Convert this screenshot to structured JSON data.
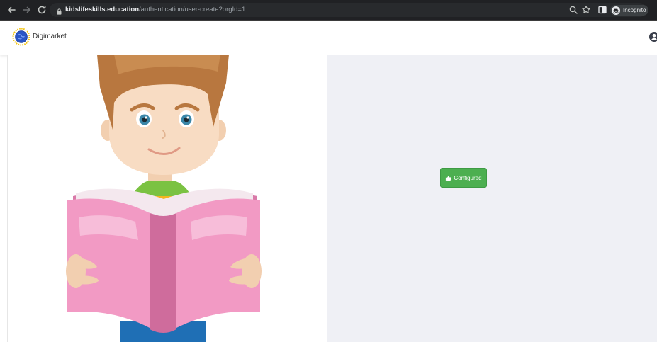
{
  "browser": {
    "url_host": "kidslifeskills.education",
    "url_path": "/authentication/user-create?orgId=1",
    "incognito_label": "Incognito"
  },
  "header": {
    "brand": "Digimarket"
  },
  "main": {
    "configured_label": "Configured"
  },
  "colors": {
    "button_green": "#4caf50",
    "panel_bg": "#eff0f5",
    "chrome_bg": "#202124"
  },
  "icons": {
    "back": "back-arrow-icon",
    "forward": "forward-arrow-icon",
    "reload": "reload-icon",
    "lock": "lock-icon",
    "zoom": "zoom-icon",
    "bookmark": "star-icon",
    "sidepanel": "side-panel-icon",
    "incognito": "incognito-icon",
    "thumbs_up": "thumbs-up-icon",
    "user": "user-circle-icon"
  }
}
